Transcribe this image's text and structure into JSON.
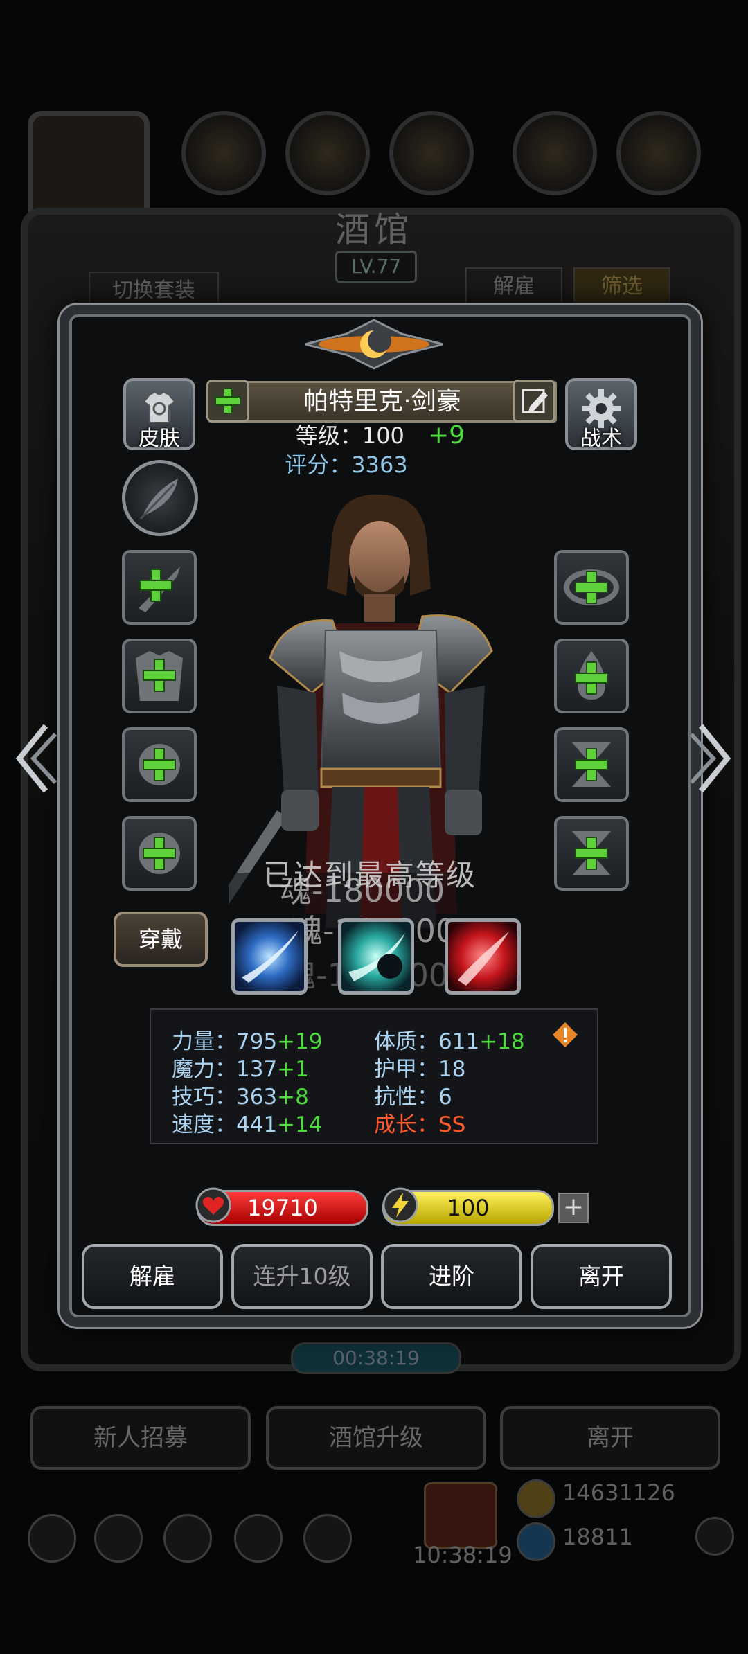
{
  "background": {
    "title": "酒馆",
    "level": "LV.77",
    "tabs": {
      "switch_outfit": "切换套装",
      "dismiss": "解雇",
      "filter": "筛选"
    },
    "timer": "00:38:19",
    "buttons": {
      "recruit": "新人招募",
      "upgrade": "酒馆升级",
      "leave": "离开"
    },
    "bottom_time": "10:38:19",
    "gold": "14631126",
    "gems": "18811"
  },
  "hero": {
    "skin_label": "皮肤",
    "tactics_label": "战术",
    "name": "帕特里克·剑豪",
    "level_label": "等级：100",
    "level_bonus": "+9",
    "score_label": "评分：3363",
    "wear_label": "穿戴",
    "max_level_text": "已达到最高等级",
    "soul_costs": [
      "魂-180000",
      "魂-105000",
      "魂-100000"
    ]
  },
  "stats": [
    {
      "label": "力量：795",
      "bonus": "+19"
    },
    {
      "label": "体质：611",
      "bonus": "+18"
    },
    {
      "label": "魔力：137",
      "bonus": "+1"
    },
    {
      "label": "护甲：18",
      "bonus": ""
    },
    {
      "label": "技巧：363",
      "bonus": "+8"
    },
    {
      "label": "抗性：6",
      "bonus": ""
    },
    {
      "label": "速度：441",
      "bonus": "+14"
    },
    {
      "label": "成长：SS",
      "bonus": ""
    }
  ],
  "vitals": {
    "hp": "19710",
    "energy": "100",
    "energy_plus": "+"
  },
  "actions": {
    "dismiss": "解雇",
    "level_up_10": "连升10级",
    "advance": "进阶",
    "leave": "离开"
  },
  "colors": {
    "bonus_green": "#4cdc3c",
    "stat_blue": "#a9d3f0",
    "growth_red": "#ff5a2a",
    "warning_orange": "#e8862a"
  }
}
